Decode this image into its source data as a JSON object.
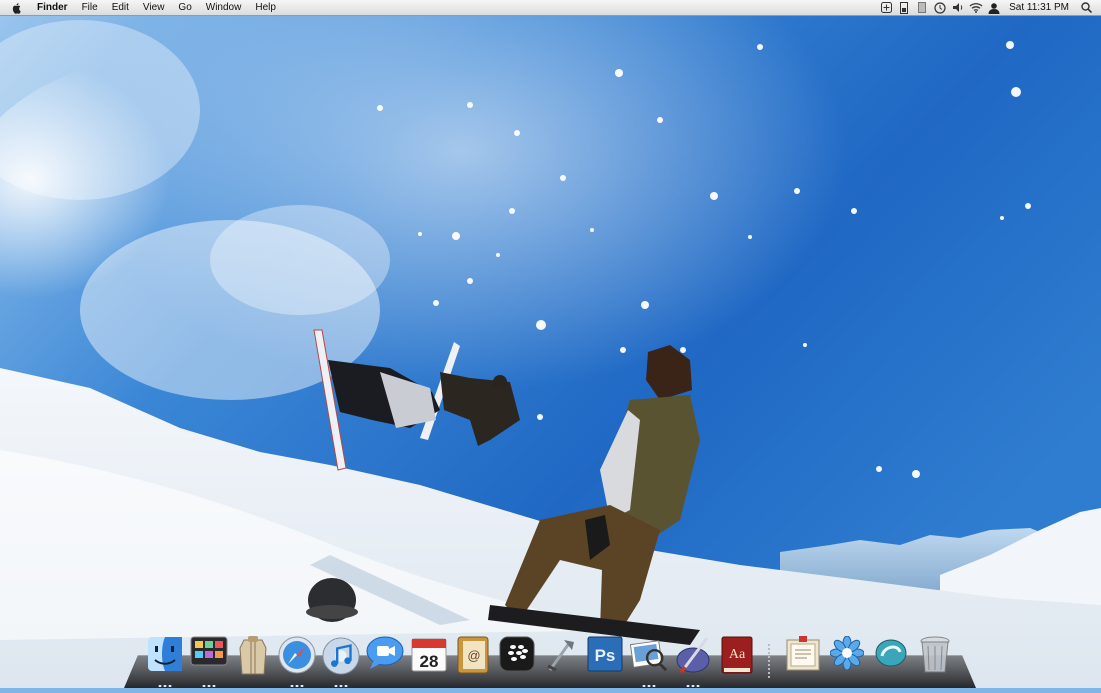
{
  "menubar": {
    "app_name": "Finder",
    "menus": [
      "File",
      "Edit",
      "View",
      "Go",
      "Window",
      "Help"
    ],
    "clock": "Sat 11:31 PM",
    "status_icons": [
      "add-icon",
      "battery-monitor-icon",
      "menu-extra-icon",
      "time-machine-icon",
      "volume-icon",
      "wifi-icon",
      "user-icon",
      "spotlight-search-icon"
    ]
  },
  "dock": {
    "apps": [
      {
        "name": "Finder",
        "icon": "finder-icon",
        "running": true
      },
      {
        "name": "Dashboard",
        "icon": "dashboard-icon",
        "running": true
      },
      {
        "name": "Archive",
        "icon": "archive-icon",
        "running": false
      },
      {
        "name": "Safari",
        "icon": "safari-icon",
        "running": true
      },
      {
        "name": "iTunes",
        "icon": "itunes-icon",
        "running": true
      },
      {
        "name": "iChat",
        "icon": "ichat-icon",
        "running": false
      },
      {
        "name": "iCal",
        "icon": "ical-icon",
        "running": false,
        "label": "28"
      },
      {
        "name": "Address Book",
        "icon": "address-book-icon",
        "running": false
      },
      {
        "name": "BlackBerry",
        "icon": "blackberry-icon",
        "running": false
      },
      {
        "name": "Xcode",
        "icon": "xcode-icon",
        "running": false
      },
      {
        "name": "Photoshop",
        "icon": "photoshop-icon",
        "running": false,
        "label": "Ps"
      },
      {
        "name": "Preview",
        "icon": "preview-icon",
        "running": true
      },
      {
        "name": "Brushes",
        "icon": "brush-icon",
        "running": true
      },
      {
        "name": "Dictionary",
        "icon": "dictionary-icon",
        "running": false,
        "label": "Aa"
      }
    ],
    "docs": [
      {
        "name": "Documents",
        "icon": "documents-stack-icon"
      },
      {
        "name": "Flower",
        "icon": "flower-icon"
      },
      {
        "name": "Dock Widget",
        "icon": "widget-icon"
      },
      {
        "name": "Trash",
        "icon": "trash-icon"
      }
    ],
    "accent": "#4a90e2"
  }
}
